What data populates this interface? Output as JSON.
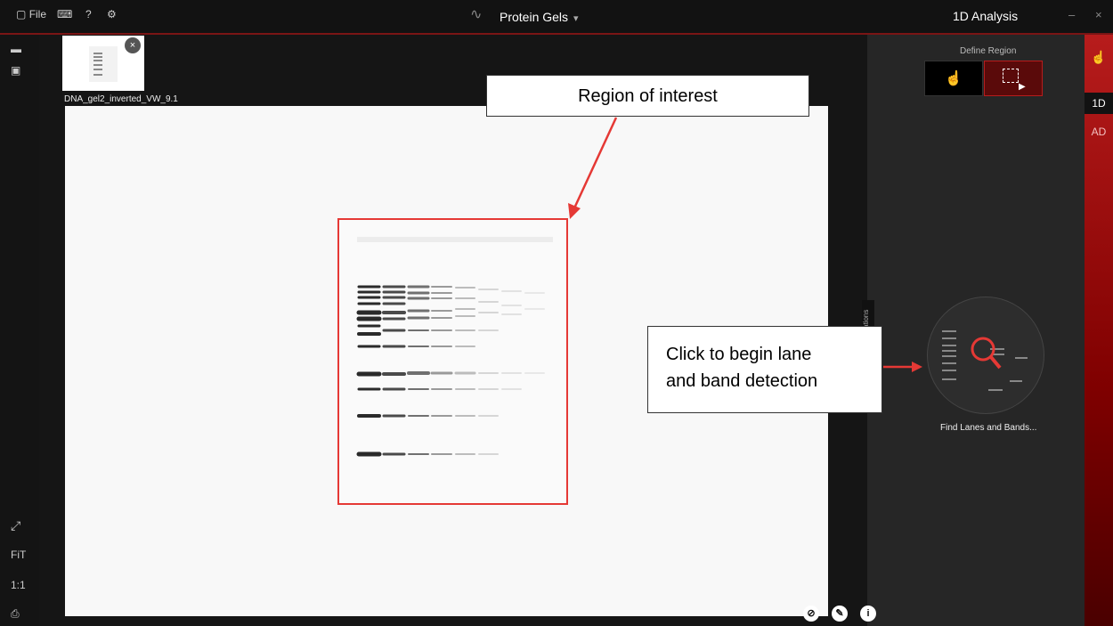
{
  "topbar": {
    "file_label": "File",
    "help_label": "?",
    "app_title": "Protein Gels",
    "panel_title": "1D Analysis",
    "minimize_label": "–",
    "close_label": "×"
  },
  "left_toolbar": {
    "fit_label": "FiT",
    "one_to_one_label": "1:1"
  },
  "thumbnail": {
    "filename": "DNA_gel2_inverted_VW_9.1"
  },
  "callouts": {
    "region_of_interest": "Region of interest",
    "lane_detection_line1": "Click to begin lane",
    "lane_detection_line2": "and band detection"
  },
  "right_panel": {
    "define_region_label": "Define Region",
    "find_lanes_label": "Find Lanes and Bands...",
    "side_tab_label": "ations"
  },
  "right_rail": {
    "item_1d": "1D",
    "item_ad": "AD"
  },
  "bottom_toolbar": {
    "info_label": "i"
  },
  "colors": {
    "accent_red": "#b71c1c",
    "roi_border": "#e53935",
    "dark_bg": "#1b1b1b"
  },
  "icons": [
    "file-icon",
    "keyboard-icon",
    "help-icon",
    "gear-icon",
    "app-logo-icon",
    "chevron-down-icon",
    "folder-icon",
    "save-icon",
    "expand-icon",
    "print-icon",
    "hand-pointer-icon",
    "rectangle-select-icon",
    "magnifier-icon",
    "touch-icon",
    "hide-icon",
    "pencil-icon",
    "info-icon",
    "arrow-icon"
  ]
}
